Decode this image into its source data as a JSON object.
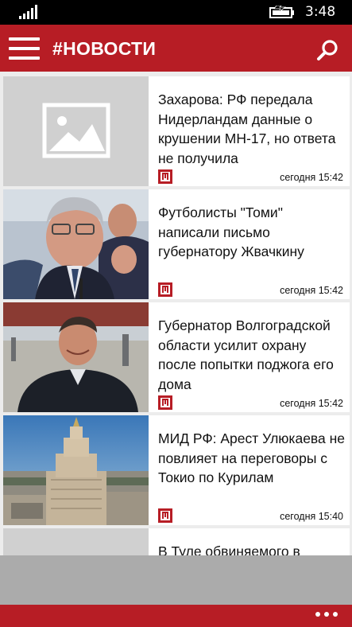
{
  "status": {
    "time": "3:48"
  },
  "header": {
    "title": "#НОВОСТИ"
  },
  "feed": [
    {
      "headline": "Захарова: РФ передала Нидерландам данные о крушении МН-17, но ответа не получила",
      "time": "сегодня 15:42"
    },
    {
      "headline": "Футболисты \"Томи\" написали письмо губернатору Жвачкину",
      "time": "сегодня 15:42"
    },
    {
      "headline": "Губернатор Волгоградской области усилит охрану после попытки поджога его дома",
      "time": "сегодня 15:42"
    },
    {
      "headline": "МИД РФ: Арест Улюкаева не повлияет на переговоры с Токио по Курилам",
      "time": "сегодня 15:40"
    },
    {
      "headline": "В Туле обвиняемого в"
    }
  ],
  "colors": {
    "brand": "#b71d25",
    "background": "#ececec"
  },
  "icons": {
    "menu": "hamburger-icon",
    "search": "search-icon",
    "more": "more-dots-icon",
    "source": "source-logo-icon",
    "placeholder": "image-placeholder-icon"
  }
}
